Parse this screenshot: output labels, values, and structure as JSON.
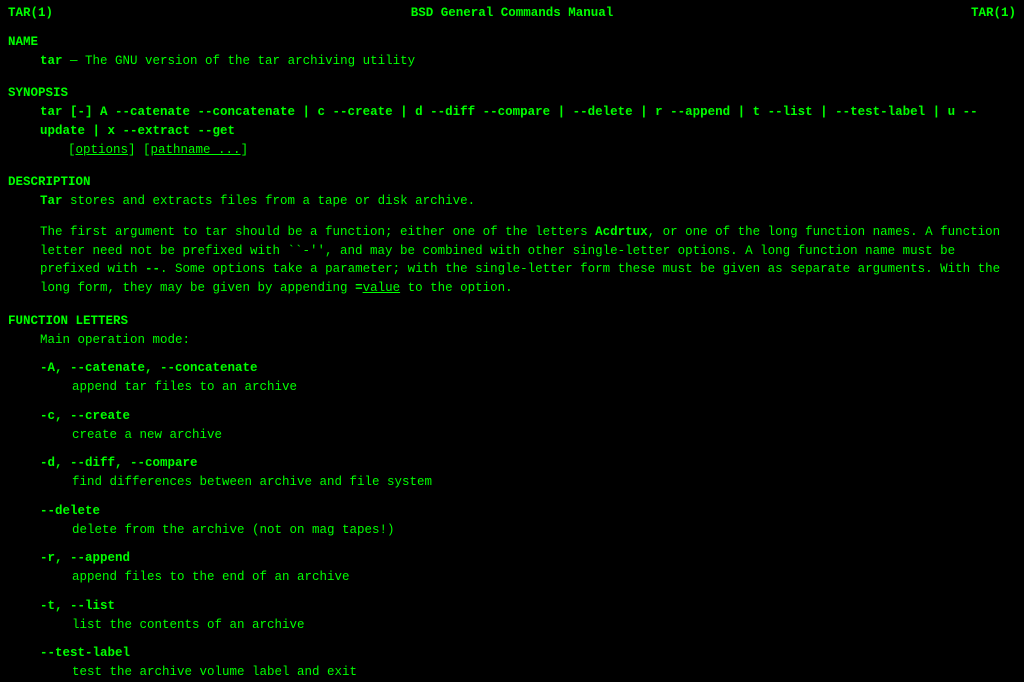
{
  "header": {
    "left": "TAR(1)",
    "center": "BSD General Commands Manual",
    "right": "TAR(1)"
  },
  "name": {
    "title": "NAME",
    "cmd": "tar",
    "dash": " — ",
    "desc": "The GNU version of the tar archiving utility"
  },
  "synopsis": {
    "title": "SYNOPSIS",
    "cmd": "tar",
    "rest": " [-] A --catenate --concatenate | c --create | d --diff --compare | --delete | r --append | t --list | --test-label | u --update | x --extract --get",
    "line2a": "[",
    "line2_opt": "options",
    "line2b": "] [",
    "line2_path": "pathname ...",
    "line2c": "]"
  },
  "description": {
    "title": "DESCRIPTION",
    "p1a": "Tar",
    "p1b": " stores and extracts files from a tape or disk archive.",
    "p2a": "The first argument to tar should be a function; either one of the letters ",
    "p2b": "Acdrtux",
    "p2c": ", or one of the long function names.  A function letter need not be prefixed with ``-'', and may be combined with other single-letter options.  A long function name must be prefixed with ",
    "p2d": "--",
    "p2e": ".  Some options take a parameter; with the single-letter form these must be given as separate arguments.  With the long form, they may be given by appending ",
    "p2f": "=",
    "p2g": "value",
    "p2h": " to the option."
  },
  "func": {
    "title": "FUNCTION LETTERS",
    "intro": "Main operation mode:",
    "items": [
      {
        "flags": "-A, --catenate, --concatenate",
        "desc": "append tar files to an archive"
      },
      {
        "flags": "-c, --create",
        "desc": "create a new archive"
      },
      {
        "flags": "-d, --diff, --compare",
        "desc": "find differences between archive and file system"
      },
      {
        "flags": "--delete",
        "desc": "delete from the archive (not on mag tapes!)"
      },
      {
        "flags": "-r, --append",
        "desc": "append files to the end of an archive"
      },
      {
        "flags": "-t, --list",
        "desc": "list the contents of an archive"
      },
      {
        "flags": "--test-label",
        "desc": "test the archive volume label and exit"
      }
    ]
  }
}
